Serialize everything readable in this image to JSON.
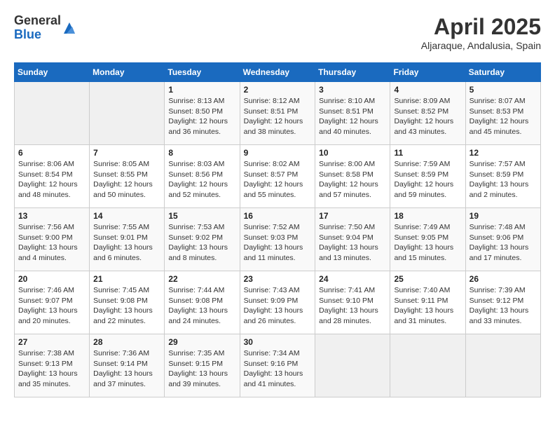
{
  "logo": {
    "general": "General",
    "blue": "Blue"
  },
  "title": "April 2025",
  "location": "Aljaraque, Andalusia, Spain",
  "headers": [
    "Sunday",
    "Monday",
    "Tuesday",
    "Wednesday",
    "Thursday",
    "Friday",
    "Saturday"
  ],
  "weeks": [
    [
      {
        "day": "",
        "sunrise": "",
        "sunset": "",
        "daylight": ""
      },
      {
        "day": "",
        "sunrise": "",
        "sunset": "",
        "daylight": ""
      },
      {
        "day": "1",
        "sunrise": "Sunrise: 8:13 AM",
        "sunset": "Sunset: 8:50 PM",
        "daylight": "Daylight: 12 hours and 36 minutes."
      },
      {
        "day": "2",
        "sunrise": "Sunrise: 8:12 AM",
        "sunset": "Sunset: 8:51 PM",
        "daylight": "Daylight: 12 hours and 38 minutes."
      },
      {
        "day": "3",
        "sunrise": "Sunrise: 8:10 AM",
        "sunset": "Sunset: 8:51 PM",
        "daylight": "Daylight: 12 hours and 40 minutes."
      },
      {
        "day": "4",
        "sunrise": "Sunrise: 8:09 AM",
        "sunset": "Sunset: 8:52 PM",
        "daylight": "Daylight: 12 hours and 43 minutes."
      },
      {
        "day": "5",
        "sunrise": "Sunrise: 8:07 AM",
        "sunset": "Sunset: 8:53 PM",
        "daylight": "Daylight: 12 hours and 45 minutes."
      }
    ],
    [
      {
        "day": "6",
        "sunrise": "Sunrise: 8:06 AM",
        "sunset": "Sunset: 8:54 PM",
        "daylight": "Daylight: 12 hours and 48 minutes."
      },
      {
        "day": "7",
        "sunrise": "Sunrise: 8:05 AM",
        "sunset": "Sunset: 8:55 PM",
        "daylight": "Daylight: 12 hours and 50 minutes."
      },
      {
        "day": "8",
        "sunrise": "Sunrise: 8:03 AM",
        "sunset": "Sunset: 8:56 PM",
        "daylight": "Daylight: 12 hours and 52 minutes."
      },
      {
        "day": "9",
        "sunrise": "Sunrise: 8:02 AM",
        "sunset": "Sunset: 8:57 PM",
        "daylight": "Daylight: 12 hours and 55 minutes."
      },
      {
        "day": "10",
        "sunrise": "Sunrise: 8:00 AM",
        "sunset": "Sunset: 8:58 PM",
        "daylight": "Daylight: 12 hours and 57 minutes."
      },
      {
        "day": "11",
        "sunrise": "Sunrise: 7:59 AM",
        "sunset": "Sunset: 8:59 PM",
        "daylight": "Daylight: 12 hours and 59 minutes."
      },
      {
        "day": "12",
        "sunrise": "Sunrise: 7:57 AM",
        "sunset": "Sunset: 8:59 PM",
        "daylight": "Daylight: 13 hours and 2 minutes."
      }
    ],
    [
      {
        "day": "13",
        "sunrise": "Sunrise: 7:56 AM",
        "sunset": "Sunset: 9:00 PM",
        "daylight": "Daylight: 13 hours and 4 minutes."
      },
      {
        "day": "14",
        "sunrise": "Sunrise: 7:55 AM",
        "sunset": "Sunset: 9:01 PM",
        "daylight": "Daylight: 13 hours and 6 minutes."
      },
      {
        "day": "15",
        "sunrise": "Sunrise: 7:53 AM",
        "sunset": "Sunset: 9:02 PM",
        "daylight": "Daylight: 13 hours and 8 minutes."
      },
      {
        "day": "16",
        "sunrise": "Sunrise: 7:52 AM",
        "sunset": "Sunset: 9:03 PM",
        "daylight": "Daylight: 13 hours and 11 minutes."
      },
      {
        "day": "17",
        "sunrise": "Sunrise: 7:50 AM",
        "sunset": "Sunset: 9:04 PM",
        "daylight": "Daylight: 13 hours and 13 minutes."
      },
      {
        "day": "18",
        "sunrise": "Sunrise: 7:49 AM",
        "sunset": "Sunset: 9:05 PM",
        "daylight": "Daylight: 13 hours and 15 minutes."
      },
      {
        "day": "19",
        "sunrise": "Sunrise: 7:48 AM",
        "sunset": "Sunset: 9:06 PM",
        "daylight": "Daylight: 13 hours and 17 minutes."
      }
    ],
    [
      {
        "day": "20",
        "sunrise": "Sunrise: 7:46 AM",
        "sunset": "Sunset: 9:07 PM",
        "daylight": "Daylight: 13 hours and 20 minutes."
      },
      {
        "day": "21",
        "sunrise": "Sunrise: 7:45 AM",
        "sunset": "Sunset: 9:08 PM",
        "daylight": "Daylight: 13 hours and 22 minutes."
      },
      {
        "day": "22",
        "sunrise": "Sunrise: 7:44 AM",
        "sunset": "Sunset: 9:08 PM",
        "daylight": "Daylight: 13 hours and 24 minutes."
      },
      {
        "day": "23",
        "sunrise": "Sunrise: 7:43 AM",
        "sunset": "Sunset: 9:09 PM",
        "daylight": "Daylight: 13 hours and 26 minutes."
      },
      {
        "day": "24",
        "sunrise": "Sunrise: 7:41 AM",
        "sunset": "Sunset: 9:10 PM",
        "daylight": "Daylight: 13 hours and 28 minutes."
      },
      {
        "day": "25",
        "sunrise": "Sunrise: 7:40 AM",
        "sunset": "Sunset: 9:11 PM",
        "daylight": "Daylight: 13 hours and 31 minutes."
      },
      {
        "day": "26",
        "sunrise": "Sunrise: 7:39 AM",
        "sunset": "Sunset: 9:12 PM",
        "daylight": "Daylight: 13 hours and 33 minutes."
      }
    ],
    [
      {
        "day": "27",
        "sunrise": "Sunrise: 7:38 AM",
        "sunset": "Sunset: 9:13 PM",
        "daylight": "Daylight: 13 hours and 35 minutes."
      },
      {
        "day": "28",
        "sunrise": "Sunrise: 7:36 AM",
        "sunset": "Sunset: 9:14 PM",
        "daylight": "Daylight: 13 hours and 37 minutes."
      },
      {
        "day": "29",
        "sunrise": "Sunrise: 7:35 AM",
        "sunset": "Sunset: 9:15 PM",
        "daylight": "Daylight: 13 hours and 39 minutes."
      },
      {
        "day": "30",
        "sunrise": "Sunrise: 7:34 AM",
        "sunset": "Sunset: 9:16 PM",
        "daylight": "Daylight: 13 hours and 41 minutes."
      },
      {
        "day": "",
        "sunrise": "",
        "sunset": "",
        "daylight": ""
      },
      {
        "day": "",
        "sunrise": "",
        "sunset": "",
        "daylight": ""
      },
      {
        "day": "",
        "sunrise": "",
        "sunset": "",
        "daylight": ""
      }
    ]
  ]
}
